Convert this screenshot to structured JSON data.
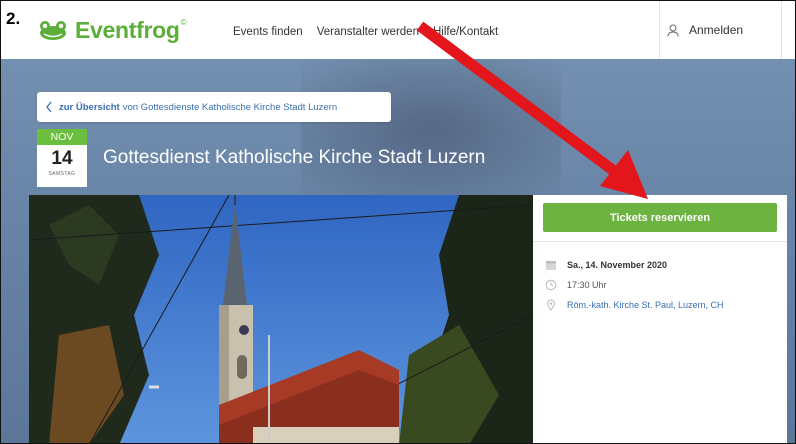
{
  "annotation": {
    "step_number": "2."
  },
  "logo": {
    "text": "Eventfrog",
    "sup": "©"
  },
  "nav": {
    "items": [
      {
        "label": "Events finden"
      },
      {
        "label": "Veranstalter werden"
      },
      {
        "label": "Hilfe/Kontakt"
      }
    ],
    "login_label": "Anmelden"
  },
  "breadcrumb": {
    "link_label": "zur Übersicht",
    "rest": "von Gottesdienste Katholische Kirche Stadt Luzern"
  },
  "date": {
    "month": "NOV",
    "day": "14",
    "weekday": "SAMSTAG"
  },
  "event": {
    "title": "Gottesdienst Katholische Kirche Stadt Luzern"
  },
  "sidebar": {
    "tickets_button": "Tickets reservieren",
    "date_text": "Sa., 14. November 2020",
    "time_text": "17:30 Uhr",
    "location_text": "Röm.-kath. Kirche St. Paul, Luzern, CH"
  },
  "colors": {
    "brand_green": "#6cb33f",
    "link_blue": "#3a6fb0",
    "arrow_red": "#e3161b"
  }
}
